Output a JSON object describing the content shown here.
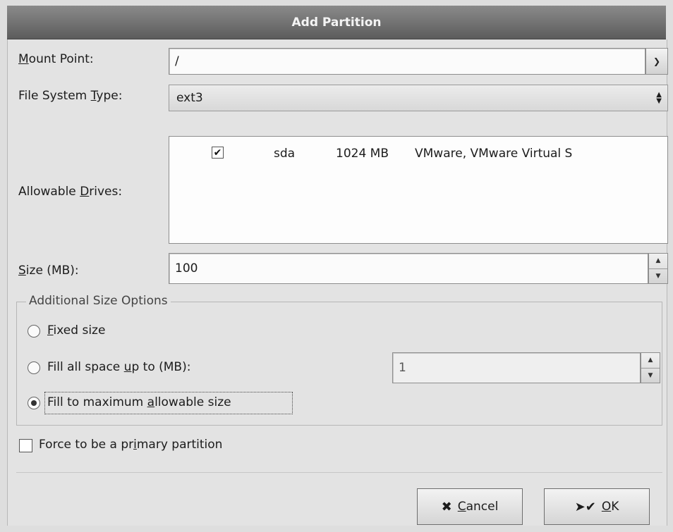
{
  "window": {
    "title": "Add Partition"
  },
  "mount_point": {
    "label": "Mount Point:",
    "value": "/"
  },
  "file_system_type": {
    "label": "File System Type:",
    "value": "ext3"
  },
  "allowable_drives": {
    "label": "Allowable Drives:",
    "drives": [
      {
        "checked": true,
        "name": "sda",
        "size": "1024 MB",
        "model": "VMware, VMware Virtual S"
      }
    ]
  },
  "size": {
    "label": "Size (MB):",
    "value": "100"
  },
  "additional_size_options": {
    "title": "Additional Size Options",
    "fixed_size": {
      "label": "Fixed size",
      "selected": false
    },
    "fill_up_to": {
      "label": "Fill all space up to (MB):",
      "selected": false,
      "value": "1"
    },
    "fill_max": {
      "label": "Fill to maximum allowable size",
      "selected": true
    }
  },
  "force_primary": {
    "label": "Force to be a primary partition",
    "checked": false
  },
  "buttons": {
    "cancel": "Cancel",
    "ok": "OK"
  },
  "icons": {
    "dropdown": "chevron-down-icon",
    "spin": "spin-arrows-icon",
    "cancel": "cancel-x-icon",
    "ok": "cursor-check-icon"
  }
}
